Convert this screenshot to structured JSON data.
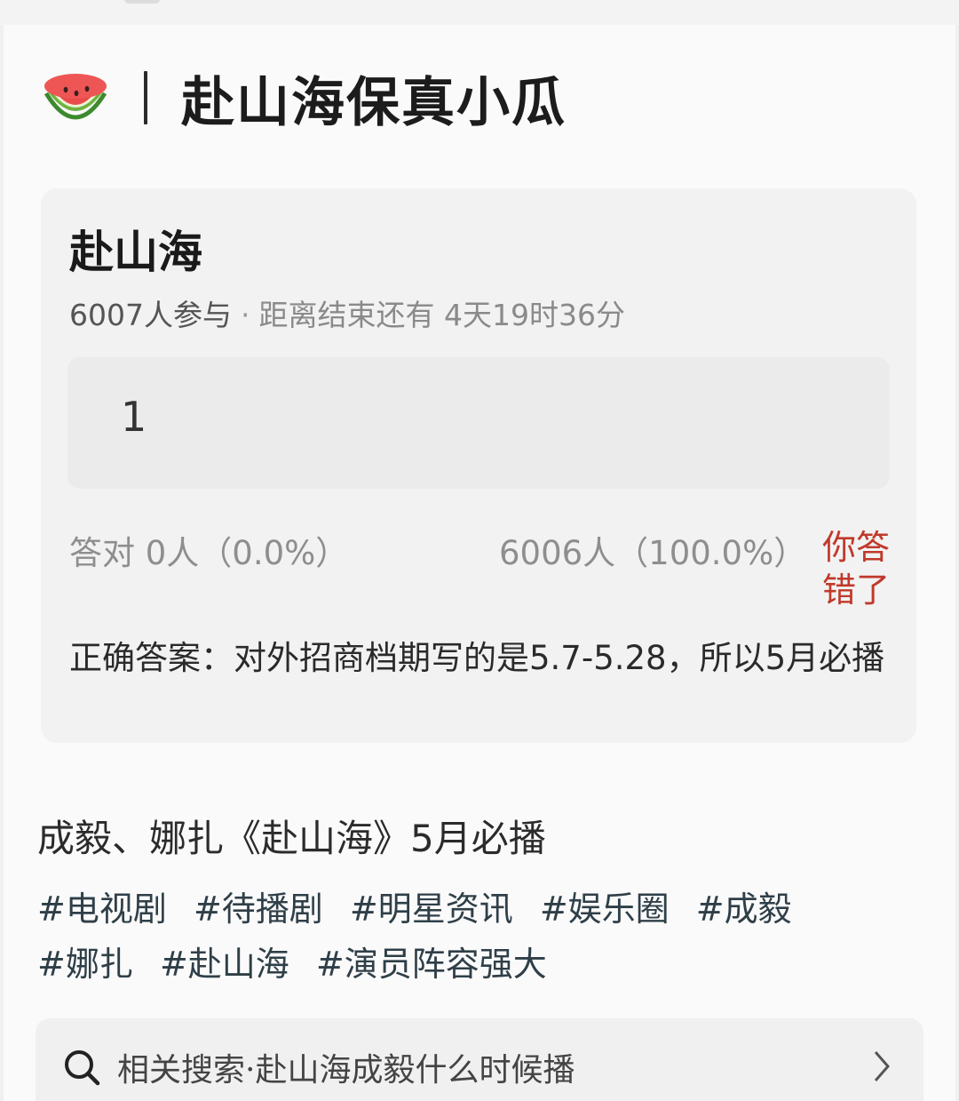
{
  "header": {
    "icon": "watermelon-icon",
    "title": "赴山海保真小瓜"
  },
  "quiz": {
    "title": "赴山海",
    "participants": "6007人参与",
    "separator": "·",
    "countdown": "距离结束还有 4天19时36分",
    "answer_value": "1",
    "correct_stat": "答对  0人（0.0%）",
    "wrong_stat": "6006人（100.0%）",
    "result_badge": "你答错了",
    "correct_answer": "正确答案：对外招商档期写的是5.7-5.28，所以5月必播"
  },
  "post": {
    "title": "成毅、娜扎《赴山海》5月必播",
    "hashtags": [
      "#电视剧",
      "#待播剧",
      "#明星资讯",
      "#娱乐圈",
      "#成毅",
      "#娜扎",
      "#赴山海",
      "#演员阵容强大"
    ]
  },
  "search": {
    "icon": "search-icon",
    "text": "相关搜索·赴山海成毅什么时候播"
  },
  "colors": {
    "wrong": "#c0392b",
    "hashtag": "#2f3f48"
  }
}
